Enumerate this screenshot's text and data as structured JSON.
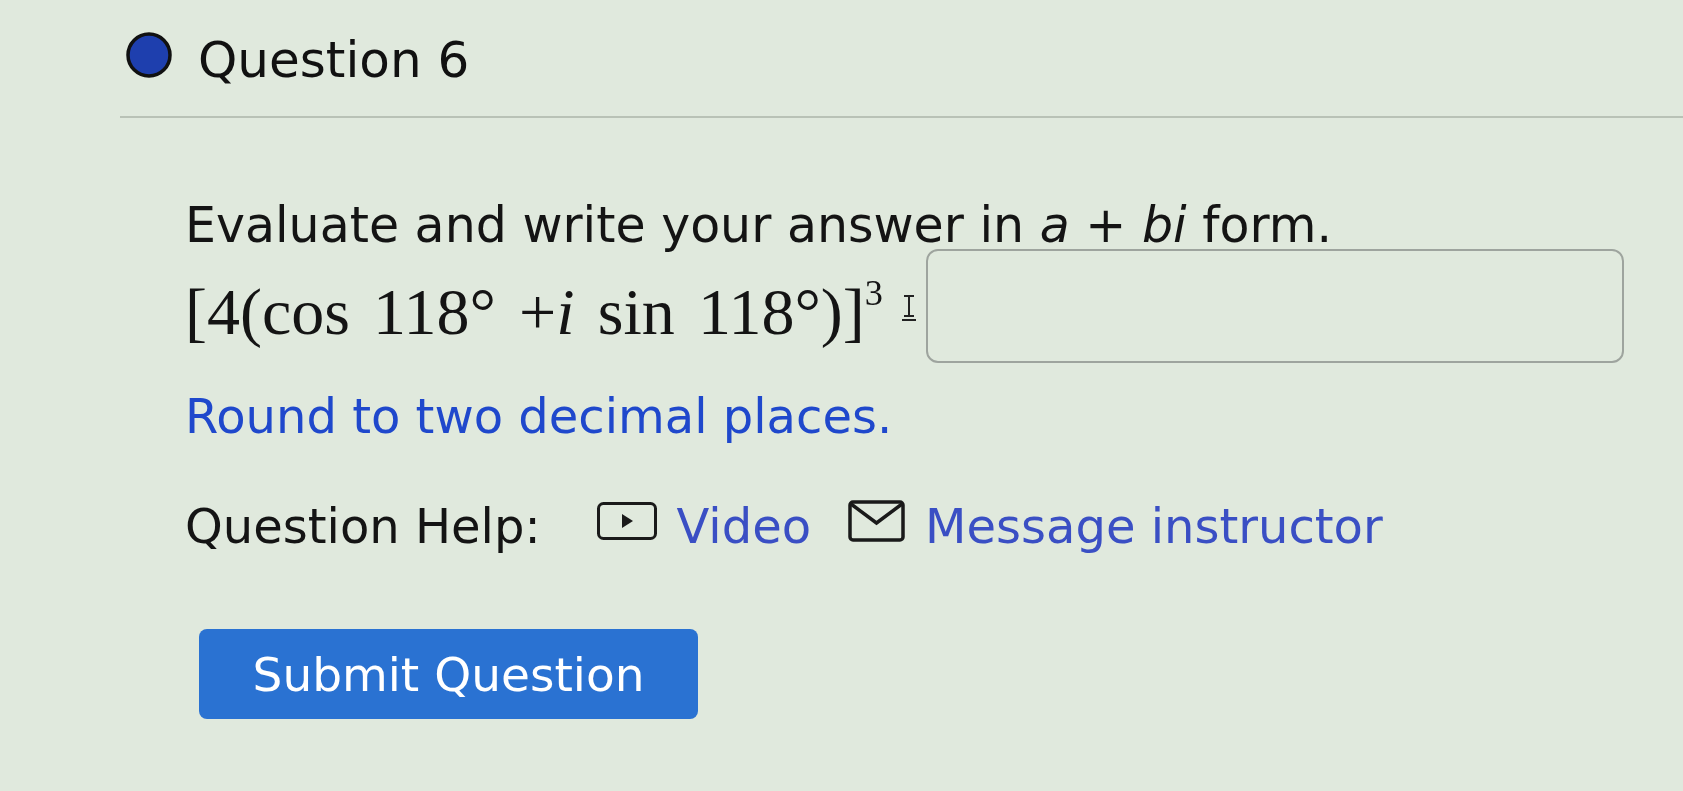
{
  "question": {
    "title": "Question 6",
    "prompt": "Evaluate and write your answer in *a* + *bi* form.",
    "expression": "[4(cos 118° +*i* sin 118°)]$^{3}$",
    "hint": "Round to two decimal places."
  },
  "help": {
    "label": "Question Help:",
    "links": [
      {
        "kind": "video",
        "label": "Video"
      },
      {
        "kind": "message",
        "label": "Message instructor"
      }
    ]
  },
  "submit_button": {
    "label": "Submit Question"
  }
}
